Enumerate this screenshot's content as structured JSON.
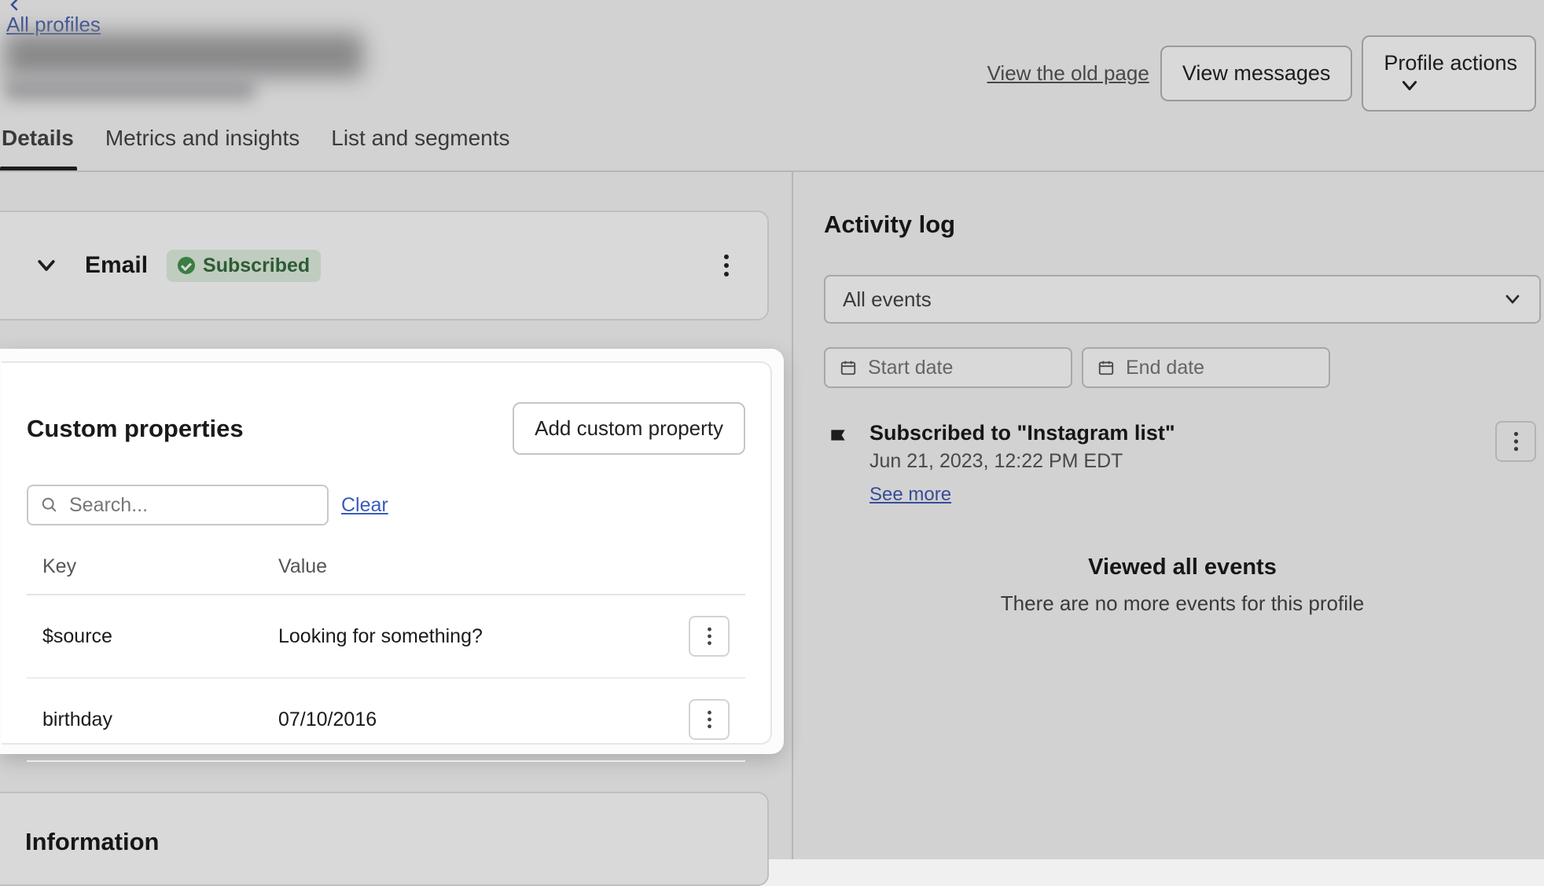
{
  "nav": {
    "back_label": "All profiles"
  },
  "header": {
    "old_page_link": "View the old page",
    "view_messages": "View messages",
    "profile_actions": "Profile actions"
  },
  "tabs": {
    "details": "Details",
    "metrics": "Metrics and insights",
    "lists": "List and segments"
  },
  "email_card": {
    "title": "Email",
    "status": "Subscribed"
  },
  "custom": {
    "title": "Custom properties",
    "add_button": "Add custom property",
    "search_placeholder": "Search...",
    "clear": "Clear",
    "col_key": "Key",
    "col_value": "Value",
    "rows": [
      {
        "key": "$source",
        "value": "Looking for something?"
      },
      {
        "key": "birthday",
        "value": "07/10/2016"
      }
    ]
  },
  "info": {
    "title": "Information"
  },
  "activity": {
    "title": "Activity log",
    "filter_label": "All events",
    "start_placeholder": "Start date",
    "end_placeholder": "End date",
    "event_title": "Subscribed to \"Instagram list\"",
    "event_date": "Jun 21, 2023, 12:22 PM EDT",
    "see_more": "See more",
    "viewed_all": "Viewed all events",
    "no_more": "There are no more events for this profile"
  },
  "icons": {
    "chevron_down": "chevron-down-icon",
    "kebab": "kebab-icon",
    "search": "search-icon",
    "calendar": "calendar-icon",
    "flag": "flag-icon",
    "arrow_left": "arrow-left-icon",
    "check": "check-icon"
  },
  "colors": {
    "link": "#3a5bbf",
    "badge_bg": "#dff1df",
    "badge_fg": "#2f6e37",
    "badge_dot": "#3a9844",
    "border": "#c5c5c8"
  }
}
